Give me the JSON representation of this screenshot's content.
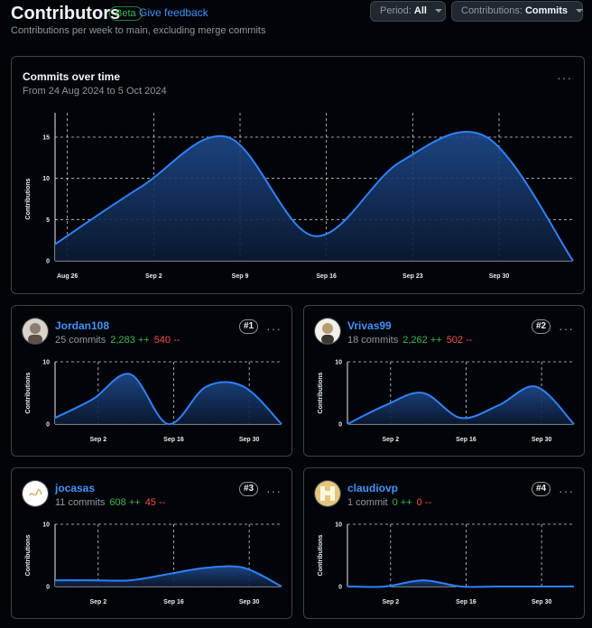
{
  "header": {
    "title": "Contributors",
    "beta": "Beta",
    "feedback": "Give feedback",
    "subtitle": "Contributions per week to main, excluding merge commits",
    "period_label": "Period:",
    "period_value": "All",
    "contrib_label": "Contributions:",
    "contrib_value": "Commits"
  },
  "colors": {
    "accent": "#4493f8",
    "line": "#2f81f7",
    "additions": "#3fb950",
    "deletions": "#f85149"
  },
  "main_chart": {
    "title": "Commits over time",
    "subtitle": "From 24 Aug 2024 to 5 Oct 2024",
    "more": "···"
  },
  "contributors": [
    {
      "username": "Jordan108",
      "commits": "25 commits",
      "additions": "2,283 ++",
      "deletions": "540 --",
      "rank": "#1",
      "avatar_icon": "user-avatar-icon"
    },
    {
      "username": "Vrivas99",
      "commits": "18 commits",
      "additions": "2,262 ++",
      "deletions": "502 --",
      "rank": "#2",
      "avatar_icon": "user-avatar-icon"
    },
    {
      "username": "jocasas",
      "commits": "11 commits",
      "additions": "608 ++",
      "deletions": "45 --",
      "rank": "#3",
      "avatar_icon": "user-avatar-icon"
    },
    {
      "username": "claudiovp",
      "commits": "1 commit",
      "additions": "0 ++",
      "deletions": "0 --",
      "rank": "#4",
      "avatar_icon": "user-avatar-icon"
    }
  ],
  "chart_data": [
    {
      "type": "area",
      "title": "Commits over time",
      "subtitle": "From 24 Aug 2024 to 5 Oct 2024",
      "ylabel": "Contributions",
      "xlabel": "",
      "x": [
        "Aug 25",
        "Sep 1",
        "Sep 8",
        "Sep 15",
        "Sep 22",
        "Sep 29",
        "Oct 6"
      ],
      "xticks": [
        "Aug 26",
        "Sep 2",
        "Sep 9",
        "Sep 16",
        "Sep 23",
        "Sep 30"
      ],
      "yticks": [
        0,
        5,
        10,
        15
      ],
      "ylim": [
        0,
        15
      ],
      "values": [
        2,
        9,
        15,
        3,
        12,
        15,
        0
      ],
      "grid": true
    },
    {
      "type": "area",
      "series_name": "Jordan108",
      "ylabel": "Contributions",
      "x": [
        "Aug 25",
        "Sep 1",
        "Sep 8",
        "Sep 15",
        "Sep 22",
        "Sep 29",
        "Oct 6"
      ],
      "xticks": [
        "Sep 2",
        "Sep 16",
        "Sep 30"
      ],
      "yticks": [
        0,
        10
      ],
      "ylim": [
        0,
        10
      ],
      "values": [
        1,
        4,
        8,
        0,
        6,
        6,
        0
      ],
      "grid": true
    },
    {
      "type": "area",
      "series_name": "Vrivas99",
      "ylabel": "Contributions",
      "x": [
        "Aug 25",
        "Sep 1",
        "Sep 8",
        "Sep 15",
        "Sep 22",
        "Sep 29",
        "Oct 6"
      ],
      "xticks": [
        "Sep 2",
        "Sep 16",
        "Sep 30"
      ],
      "yticks": [
        0,
        10
      ],
      "ylim": [
        0,
        10
      ],
      "values": [
        0,
        3,
        5,
        1,
        3,
        6,
        0
      ],
      "grid": true
    },
    {
      "type": "area",
      "series_name": "jocasas",
      "ylabel": "Contributions",
      "x": [
        "Aug 25",
        "Sep 1",
        "Sep 8",
        "Sep 15",
        "Sep 22",
        "Sep 29",
        "Oct 6"
      ],
      "xticks": [
        "Sep 2",
        "Sep 16",
        "Sep 30"
      ],
      "yticks": [
        0,
        10
      ],
      "ylim": [
        0,
        10
      ],
      "values": [
        1,
        1,
        1,
        2,
        3,
        3,
        0
      ],
      "grid": true
    },
    {
      "type": "area",
      "series_name": "claudiovp",
      "ylabel": "Contributions",
      "x": [
        "Aug 25",
        "Sep 1",
        "Sep 8",
        "Sep 15",
        "Sep 22",
        "Sep 29",
        "Oct 6"
      ],
      "xticks": [
        "Sep 2",
        "Sep 16",
        "Sep 30"
      ],
      "yticks": [
        0,
        10
      ],
      "ylim": [
        0,
        10
      ],
      "values": [
        0,
        0,
        1,
        0,
        0,
        0,
        0
      ],
      "grid": true
    }
  ]
}
